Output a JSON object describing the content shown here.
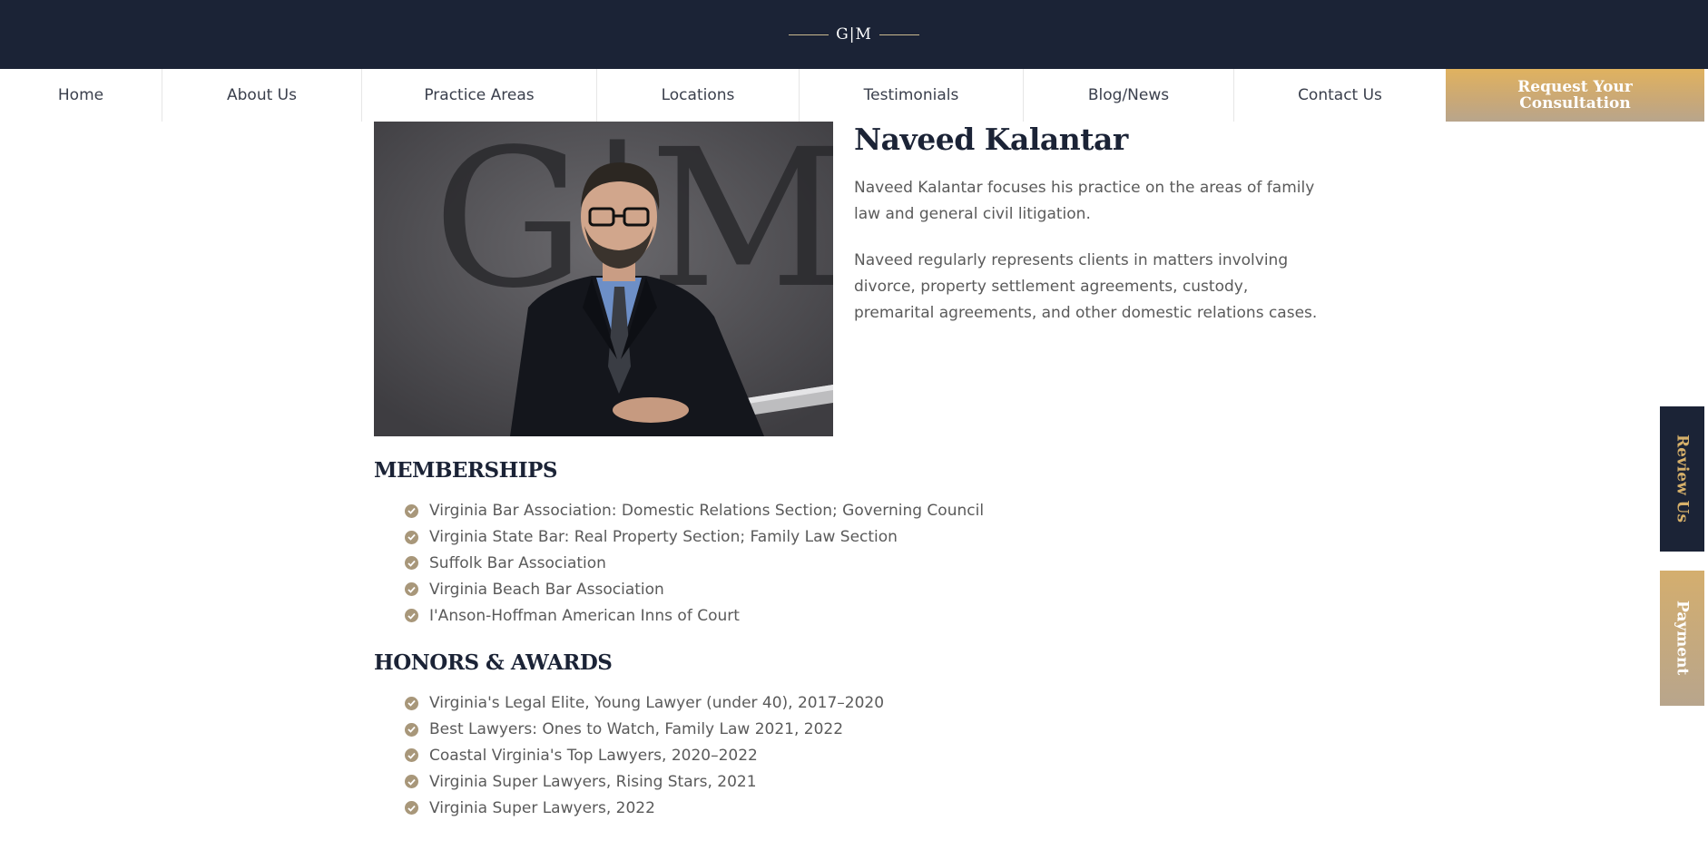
{
  "header": {
    "logo_text": "G|M",
    "background_color": "#1b2336"
  },
  "nav": {
    "items": [
      {
        "label": "Home"
      },
      {
        "label": "About Us"
      },
      {
        "label": "Practice Areas"
      },
      {
        "label": "Locations"
      },
      {
        "label": "Testimonials"
      },
      {
        "label": "Blog/News"
      },
      {
        "label": "Contact Us"
      }
    ],
    "cta_label": "Request Your Consultation",
    "cta_color": "#d4ae6e"
  },
  "profile": {
    "photo_watermark": "G|M",
    "name": "Naveed Kalantar",
    "bio": [
      "Naveed Kalantar focuses his practice on the areas of family law and general civil litigation.",
      "Naveed regularly represents clients in matters involving divorce, property settlement agreements, custody, premarital agreements, and other domestic relations cases."
    ]
  },
  "memberships": {
    "heading": "MEMBERSHIPS",
    "items": [
      "Virginia Bar Association: Domestic Relations Section; Governing Council",
      "Virginia State Bar: Real Property Section; Family Law Section",
      "Suffolk Bar Association",
      "Virginia Beach Bar Association",
      "I'Anson-Hoffman American Inns of Court"
    ]
  },
  "honors": {
    "heading": "HONORS & AWARDS",
    "items": [
      "Virginia's Legal Elite, Young Lawyer (under 40), 2017–2020",
      "Best Lawyers: Ones to Watch, Family Law 2021, 2022",
      "Coastal Virginia's Top Lawyers, 2020–2022",
      "Virginia Super Lawyers, Rising Stars, 2021",
      "Virginia Super Lawyers, 2022"
    ]
  },
  "side_tabs": {
    "review_label": "Review Us",
    "payment_label": "Payment"
  },
  "icons": {
    "list_bullet": "check-circle-icon",
    "accent_color": "#a8977a"
  }
}
